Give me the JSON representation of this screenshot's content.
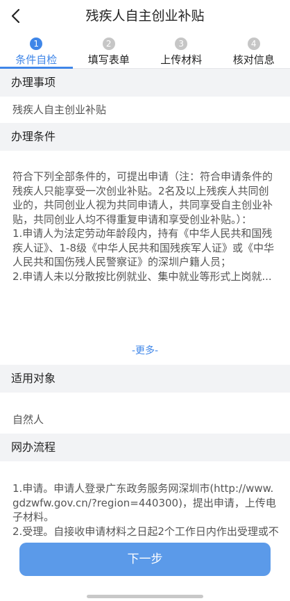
{
  "header": {
    "title": "残疾人自主创业补贴"
  },
  "steps": [
    {
      "number": "1",
      "label": "条件自检",
      "active": true
    },
    {
      "number": "2",
      "label": "填写表单",
      "active": false
    },
    {
      "number": "3",
      "label": "上传材料",
      "active": false
    },
    {
      "number": "4",
      "label": "核对信息",
      "active": false
    }
  ],
  "sections": {
    "item": {
      "title": "办理事项",
      "value": "残疾人自主创业补贴"
    },
    "conditions": {
      "title": "办理条件",
      "text": "符合下列全部条件的，可提出申请（注：符合申请条件的残疾人只能享受一次创业补贴。2名及以上残疾人共同创业的，共同创业人视为共同申请人，共同享受自主创业补贴，共同创业人均不得重复申请和享受创业补贴。）：\n1.申请人为法定劳动年龄段内，持有《中华人民共和国残疾人证》、1-8级《中华人民共和国残疾军人证》或《中华人民共和国伤残人民警察证》的深圳户籍人员；\n2.申请人未以分散按比例就业、集中就业等形式上岗就...",
      "more": "-更多-"
    },
    "target": {
      "title": "适用对象",
      "value": "自然人"
    },
    "process": {
      "title": "网办流程",
      "text": "1.申请。申请人登录广东政务服务网深圳市(http://www.gdzwfw.gov.cn/?region=440300)，提出申请，上传电子材料。\n2.受理。自接收申请材料之日起2个工作日内作出受理或不予受理决定（受理时限不计入承诺办结时限）。"
    }
  },
  "footer": {
    "next_label": "下一步"
  },
  "colors": {
    "accent": "#3f86e8",
    "button": "#5b9ae9",
    "section_bg": "#f2f3f5"
  }
}
